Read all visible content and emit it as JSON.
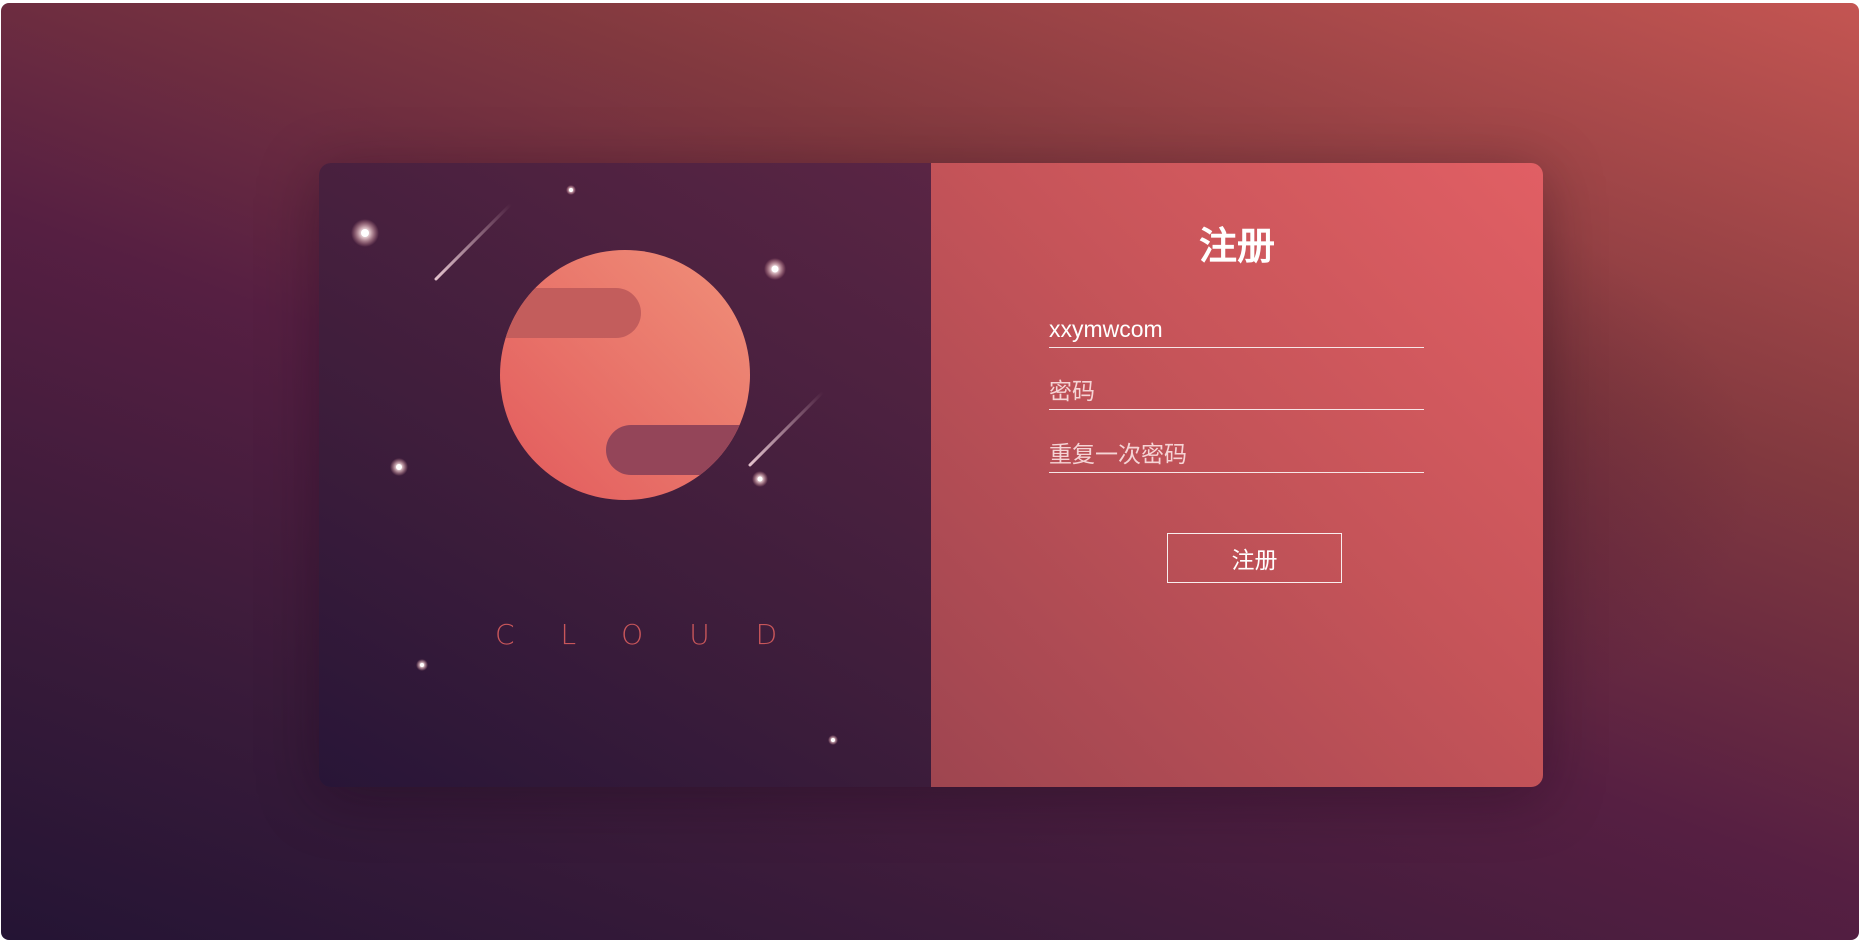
{
  "brand": {
    "name": "CLOUD",
    "logo_icon": "planet-icon"
  },
  "register": {
    "title": "注册",
    "username_value": "xxymwcom",
    "password_placeholder": "密码",
    "confirm_placeholder": "重复一次密码",
    "submit_label": "注册"
  },
  "colors": {
    "accent": "#e15f64",
    "planet": "#ea7466",
    "panel_dark": "#3d1d3b"
  }
}
